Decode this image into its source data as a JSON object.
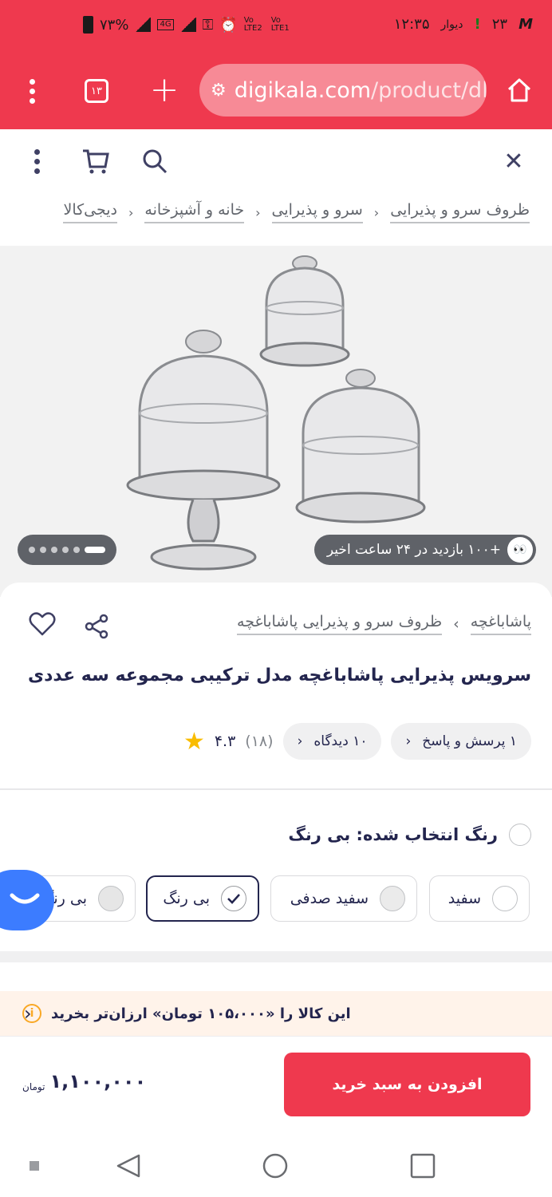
{
  "status_bar": {
    "time": "۱۲:۳۵",
    "carrier": "دیوار",
    "notif_count": "۲۳",
    "battery": "۷۳%",
    "network_label": "4G",
    "volte_1": "Vo LTE2",
    "volte_2": "Vo LTE1"
  },
  "browser": {
    "url_host": "digikala.com",
    "url_path": "/product/dl",
    "tab_count": "۱۳"
  },
  "breadcrumb": [
    "دیجی‌کالا",
    "خانه و آشپزخانه",
    "سرو و پذیرایی",
    "ظروف سرو و پذیرایی"
  ],
  "gallery": {
    "views_text": "+۱۰۰ بازدید در ۲۴ ساعت اخیر"
  },
  "product": {
    "sub_breadcrumb": [
      "پاشاباغچه",
      "ظروف سرو و پذیرایی پاشاباغچه"
    ],
    "title": "سرویس پذیرایی پاشاباغچه مدل ترکیبی مجموعه سه عددی",
    "rating": "۴.۳",
    "rating_count": "(۱۸)",
    "reviews_label": "۱۰ دیدگاه",
    "qa_label": "۱ پرسش و پاسخ"
  },
  "color": {
    "label": "رنگ انتخاب شده: بی رنگ",
    "options": [
      {
        "label": "سفید",
        "swatch": "#ffffff"
      },
      {
        "label": "سفید صدفی",
        "swatch": "#ebebeb"
      },
      {
        "label": "بی رنگ",
        "swatch": "check"
      },
      {
        "label": "بی رنگ",
        "swatch": "#e6e6e6"
      }
    ]
  },
  "cheaper": {
    "text": "این کالا را «۱۰۵،۰۰۰ تومان» ارزان‌تر بخرید"
  },
  "buy": {
    "button_label": "افزودن به سبد خرید",
    "price": "۱,۱۰۰,۰۰۰",
    "currency": "تومان"
  },
  "colors": {
    "brand": "#ef394e",
    "star": "#f9bc00",
    "fab": "#3c7cff"
  }
}
